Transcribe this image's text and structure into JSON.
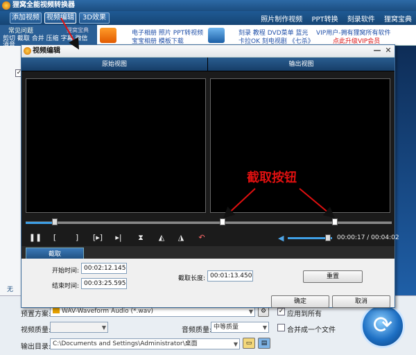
{
  "app": {
    "title": "狸窝全能视频转换器",
    "toolbar": {
      "add_video": "添加视频",
      "video_edit": "视频编辑",
      "effect_3d": "3D效果"
    },
    "top_links": [
      "照片制作视频",
      "PPT转换",
      "刻录软件",
      "狸窝宝典"
    ]
  },
  "banner": {
    "faq": "常见问题",
    "baodian": "狸窝宝典",
    "row1": [
      "剪切",
      "截取",
      "合并",
      "压缩",
      "字幕",
      "微信"
    ],
    "row2": "消音",
    "ads_group1": [
      "电子相册",
      "照片",
      "PPT转视频"
    ],
    "ads_group1b": [
      "宝宝相册",
      "模板下载"
    ],
    "ads_group2": [
      "刻录",
      "教程",
      "DVD菜单",
      "蓝光"
    ],
    "ads_group2b": [
      "卡拉OK",
      "刻电视剧",
      "《七杀》"
    ],
    "vip_line1": "VIP用户-拥有狸窝所有软件",
    "vip_line2": "点此升级VIP会员"
  },
  "dialog": {
    "title": "视频编辑",
    "original_view": "原始视图",
    "output_view": "输出视图",
    "time_readout": "00:00:17 / 00:04:02",
    "tab_label": "截取",
    "start_label": "开始时间:",
    "start_value": "00:02:12.145",
    "end_label": "结束时间:",
    "end_value": "00:03:25.595",
    "length_label": "截取长度:",
    "length_value": "00:01:13.450",
    "reset_button": "重置",
    "ok_button": "确定",
    "cancel_button": "取消",
    "timeline_progress": 0.08,
    "volume_level": 0.9
  },
  "annotation": {
    "label": "截取按钮"
  },
  "bottom": {
    "preset_label": "预置方案:",
    "preset_value": "WAV-Waveform Audio (*.wav)",
    "apply_all_label": "应用到所有",
    "video_quality_label": "视频质量:",
    "audio_quality_label": "音频质量:",
    "audio_quality_value": "中等质量",
    "merge_label": "合并成一个文件",
    "output_dir_label": "输出目录:",
    "output_dir_value": "C:\\Documents and Settings\\Administrator\\桌面",
    "side_label": "无"
  }
}
